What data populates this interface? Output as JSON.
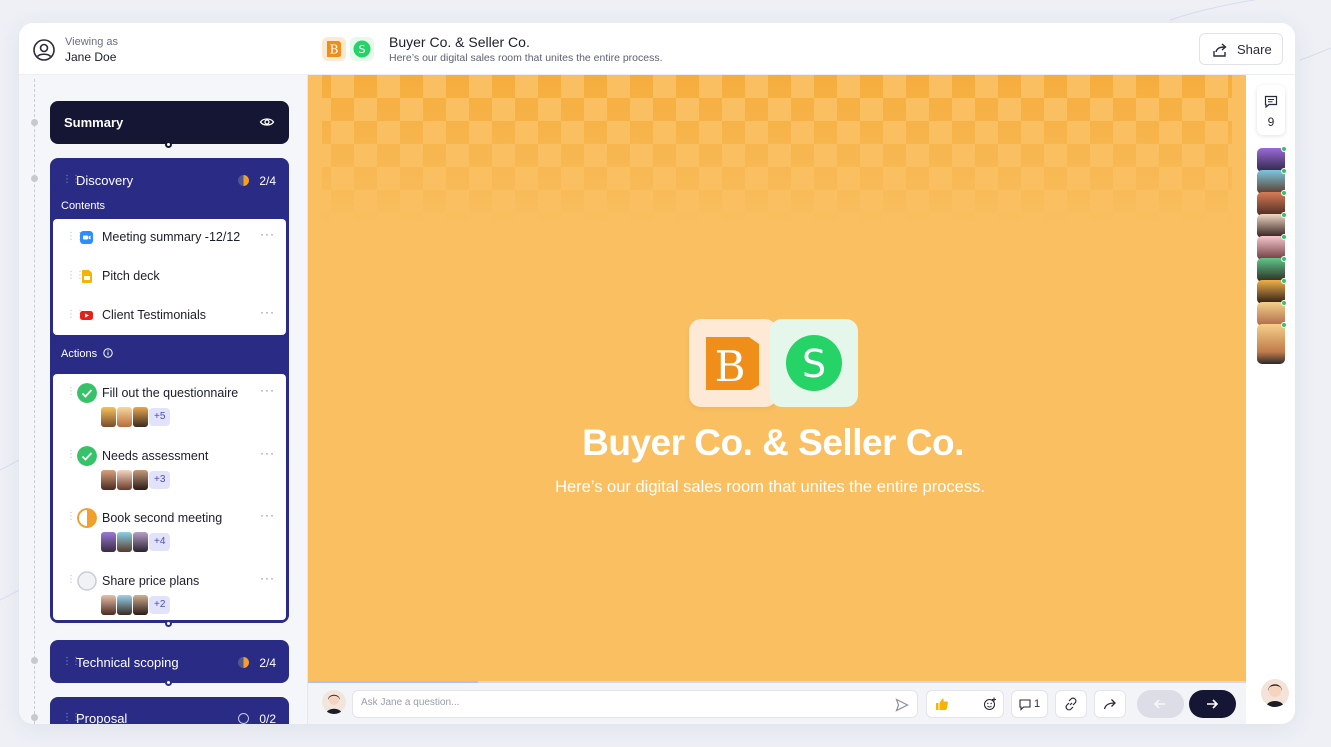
{
  "viewer": {
    "label": "Viewing as",
    "name": "Jane Doe"
  },
  "header": {
    "title": "Buyer Co. & Seller Co.",
    "subtitle": "Here’s our digital sales room that unites the entire process.",
    "share_label": "Share",
    "buyer_logo_letter": "B",
    "seller_logo_letter": "S"
  },
  "sidebar": {
    "summary_label": "Summary",
    "stages": [
      {
        "label": "Discovery",
        "count": "2/4",
        "progress": 0.5
      },
      {
        "label": "Technical scoping",
        "count": "2/4",
        "progress": 0.5
      },
      {
        "label": "Proposal",
        "count": "0/2",
        "progress": 0
      }
    ],
    "contents_label": "Contents",
    "contents": [
      {
        "label": "Meeting summary -12/12",
        "icon": "zoom-icon",
        "color": "#2d8cff"
      },
      {
        "label": "Pitch deck",
        "icon": "slides-icon",
        "color": "#f4b400"
      },
      {
        "label": "Client Testimonials",
        "icon": "youtube-icon",
        "color": "#e62117"
      }
    ],
    "actions_label": "Actions",
    "actions": [
      {
        "label": "Fill out the questionnaire",
        "status": "done",
        "more": "+5"
      },
      {
        "label": "Needs assessment",
        "status": "done",
        "more": "+3"
      },
      {
        "label": "Book second meeting",
        "status": "in-progress",
        "more": "+4"
      },
      {
        "label": "Share price plans",
        "status": "todo",
        "more": "+2"
      }
    ]
  },
  "hero": {
    "title": "Buyer Co. & Seller Co.",
    "subtitle": "Here’s our digital sales room that unites the entire process.",
    "background": "#f9bf60"
  },
  "rail": {
    "comment_count": "9"
  },
  "bottom_bar": {
    "ask_placeholder": "Ask Jane a question...",
    "comment_count": "1"
  },
  "colors": {
    "stage_bg": "#292b85",
    "summary_bg": "#151633",
    "done_green": "#37c26a",
    "in_progress_orange": "#f0a02b",
    "buyer_orange": "#ef8f1a",
    "seller_green": "#25d366"
  }
}
